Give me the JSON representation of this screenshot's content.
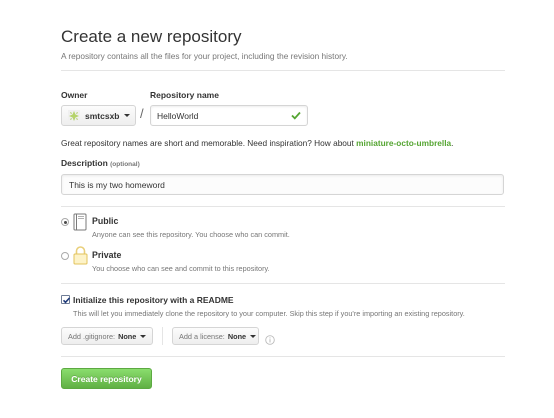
{
  "header": {
    "title": "Create a new repository",
    "subtitle": "A repository contains all the files for your project, including the revision history."
  },
  "owner": {
    "label": "Owner",
    "value": "smtcsxb",
    "avatar_icon": "identicon-avatar"
  },
  "separator": "/",
  "repository": {
    "label": "Repository name",
    "value": "HelloWorld",
    "valid_icon": "check-icon"
  },
  "suggestion": {
    "text": "Great repository names are short and memorable. Need inspiration? How about",
    "name": "miniature-octo-umbrella",
    "end": "."
  },
  "description": {
    "label": "Description",
    "optional": "(optional)",
    "value": "This is my two homeword"
  },
  "visibility": {
    "public": {
      "title": "Public",
      "note": "Anyone can see this repository. You choose who can commit.",
      "selected": true,
      "icon": "repo-book-icon"
    },
    "private": {
      "title": "Private",
      "note": "You choose who can see and commit to this repository.",
      "selected": false,
      "icon": "lock-icon"
    }
  },
  "readme": {
    "title": "Initialize this repository with a README",
    "note": "This will let you immediately clone the repository to your computer. Skip this step if you're importing an existing repository.",
    "checked": true
  },
  "gitignore": {
    "label": "Add .gitignore:",
    "value": "None"
  },
  "license": {
    "label": "Add a license:",
    "value": "None"
  },
  "create_button": "Create repository",
  "colors": {
    "accent_green": "#60b044",
    "suggestion_green": "#55a532",
    "muted_text": "#767676"
  }
}
